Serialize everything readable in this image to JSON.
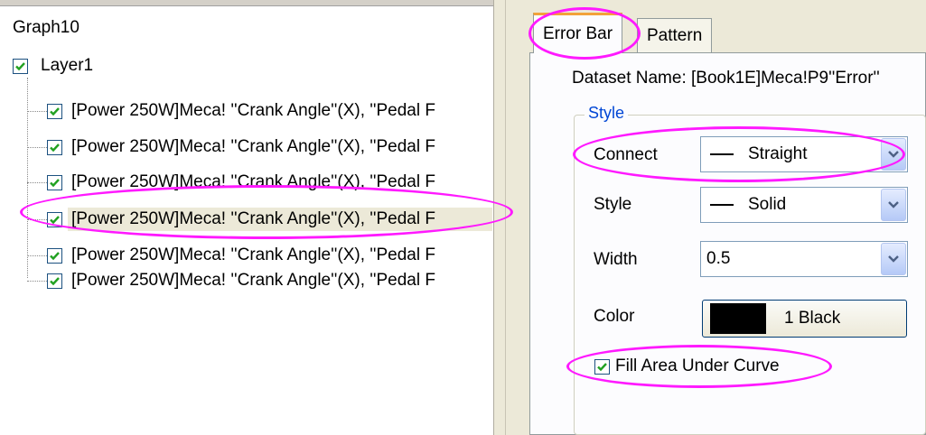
{
  "tree": {
    "root_label": "Graph10",
    "layer": {
      "label": "Layer1",
      "checked": true
    },
    "datasets": [
      {
        "label": "[Power 250W]Meca! ''Crank Angle''(X), ''Pedal F",
        "checked": true,
        "selected": false
      },
      {
        "label": "[Power 250W]Meca! ''Crank Angle''(X), ''Pedal F",
        "checked": true,
        "selected": false
      },
      {
        "label": "[Power 250W]Meca! ''Crank Angle''(X), ''Pedal F",
        "checked": true,
        "selected": false
      },
      {
        "label": "[Power 250W]Meca! ''Crank Angle''(X), ''Pedal F",
        "checked": true,
        "selected": true
      },
      {
        "label": "[Power 250W]Meca! ''Crank Angle''(X), ''Pedal F",
        "checked": true,
        "selected": false
      },
      {
        "label": "[Power 250W]Meca! ''Crank Angle''(X), ''Pedal F",
        "checked": true,
        "selected": false
      }
    ]
  },
  "tabs": [
    {
      "label": "Error Bar",
      "active": true
    },
    {
      "label": "Pattern",
      "active": false
    }
  ],
  "dataset_name": "Dataset Name: [Book1E]Meca!P9''Error''",
  "style_group": {
    "title": "Style",
    "connect": {
      "label": "Connect",
      "value": "Straight"
    },
    "style": {
      "label": "Style",
      "value": "Solid"
    },
    "width": {
      "label": "Width",
      "value": "0.5"
    },
    "color": {
      "label": "Color",
      "value": "1 Black",
      "swatch": "#000000"
    }
  },
  "fill_area": {
    "label": "Fill Area Under Curve",
    "checked": true
  },
  "colors": {
    "callout": "#ff19ff",
    "check": "#21a121",
    "group_title": "#0046d5",
    "selection": "#ece9d8"
  }
}
